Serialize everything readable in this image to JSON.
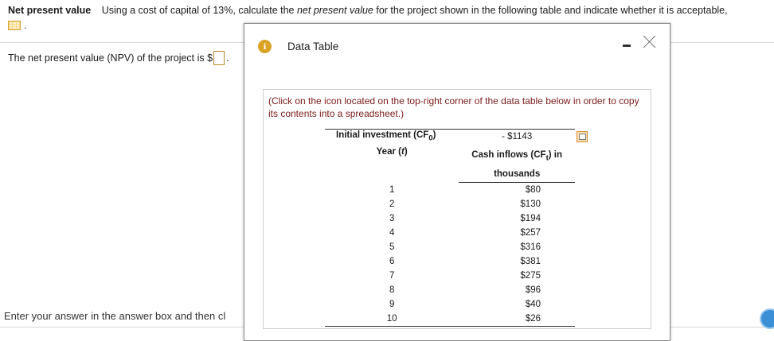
{
  "question": {
    "title": "Net present value",
    "text_before_em": "Using a cost of capital of 13%, calculate the ",
    "text_em": "net present value",
    "text_after_em": " for the project shown in the following table and indicate whether it is acceptable,",
    "icon": "spreadsheet-icon",
    "icon_suffix": "."
  },
  "answer": {
    "label": "The net present value (NPV) of the project is $",
    "value": "",
    "suffix": "."
  },
  "footer": {
    "instruction": "Enter your answer in the answer box and then cl"
  },
  "modal": {
    "title": "Data Table",
    "note": "(Click on the icon located on the top-right corner of the data table below in order to copy its contents into a spreadsheet.)",
    "initial_investment": {
      "label": "Initial investment (CF",
      "sub": "0",
      "label_end": ")",
      "value": "- $1143"
    },
    "header": {
      "year_label": "Year (",
      "year_var": "t",
      "year_end": ")",
      "cf_label": "Cash inflows (CF",
      "cf_sub": "t",
      "cf_end": ") in",
      "cf_units": "thousands"
    },
    "rows": [
      {
        "year": "1",
        "cash": "$80"
      },
      {
        "year": "2",
        "cash": "$130"
      },
      {
        "year": "3",
        "cash": "$194"
      },
      {
        "year": "4",
        "cash": "$257"
      },
      {
        "year": "5",
        "cash": "$316"
      },
      {
        "year": "6",
        "cash": "$381"
      },
      {
        "year": "7",
        "cash": "$275"
      },
      {
        "year": "8",
        "cash": "$96"
      },
      {
        "year": "9",
        "cash": "$40"
      },
      {
        "year": "10",
        "cash": "$26"
      }
    ]
  }
}
